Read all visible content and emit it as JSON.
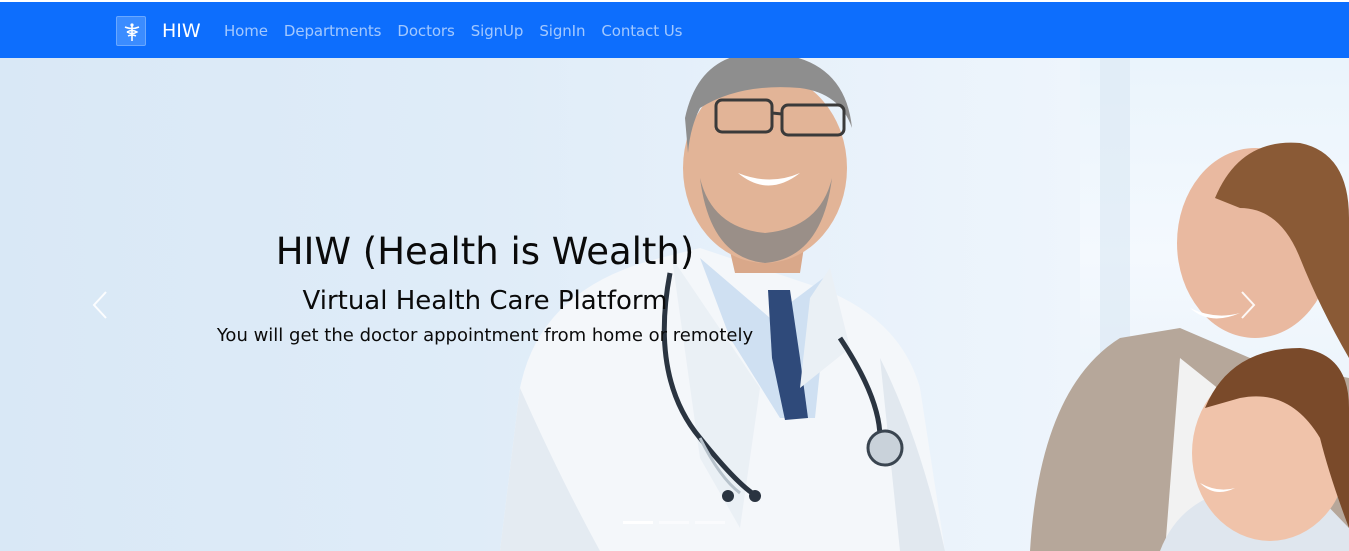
{
  "navbar": {
    "brand": "HIW",
    "links": [
      "Home",
      "Departments",
      "Doctors",
      "SignUp",
      "SignIn",
      "Contact Us"
    ],
    "bg_color": "#0d6efd"
  },
  "hero": {
    "title": "HIW (Health is Wealth)",
    "subtitle": "Virtual Health Care Platform",
    "description": "You will get the doctor appointment from home or remotely",
    "slide_count": 3,
    "active_slide": 1
  },
  "icons": {
    "brand": "caduceus-icon",
    "prev": "chevron-left-icon",
    "next": "chevron-right-icon"
  }
}
